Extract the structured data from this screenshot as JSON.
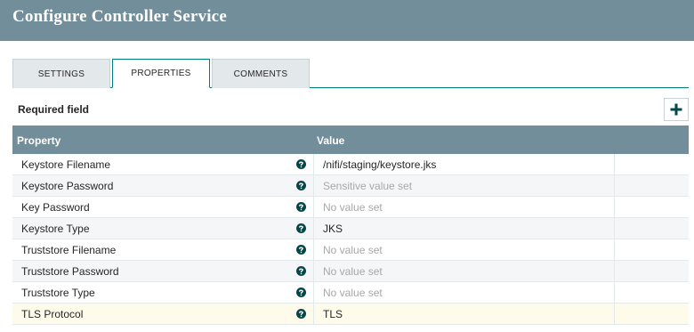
{
  "dialog": {
    "title": "Configure Controller Service"
  },
  "tabs": [
    {
      "label": "SETTINGS"
    },
    {
      "label": "PROPERTIES"
    },
    {
      "label": "COMMENTS"
    }
  ],
  "required_label": "Required field",
  "add_icon": "plus-icon",
  "grid": {
    "columns": {
      "property": "Property",
      "value": "Value"
    },
    "rows": [
      {
        "name": "Keystore Filename",
        "value": "/nifi/staging/keystore.jks",
        "state": "set"
      },
      {
        "name": "Keystore Password",
        "value": "Sensitive value set",
        "state": "unset"
      },
      {
        "name": "Key Password",
        "value": "No value set",
        "state": "unset"
      },
      {
        "name": "Keystore Type",
        "value": "JKS",
        "state": "set"
      },
      {
        "name": "Truststore Filename",
        "value": "No value set",
        "state": "unset"
      },
      {
        "name": "Truststore Password",
        "value": "No value set",
        "state": "unset"
      },
      {
        "name": "Truststore Type",
        "value": "No value set",
        "state": "unset"
      },
      {
        "name": "TLS Protocol",
        "value": "TLS",
        "state": "set"
      }
    ]
  },
  "colors": {
    "header_bg": "#728e9b",
    "accent": "#004849",
    "selected_row": "#fffbea",
    "unset_text": "#a8a8a8"
  }
}
